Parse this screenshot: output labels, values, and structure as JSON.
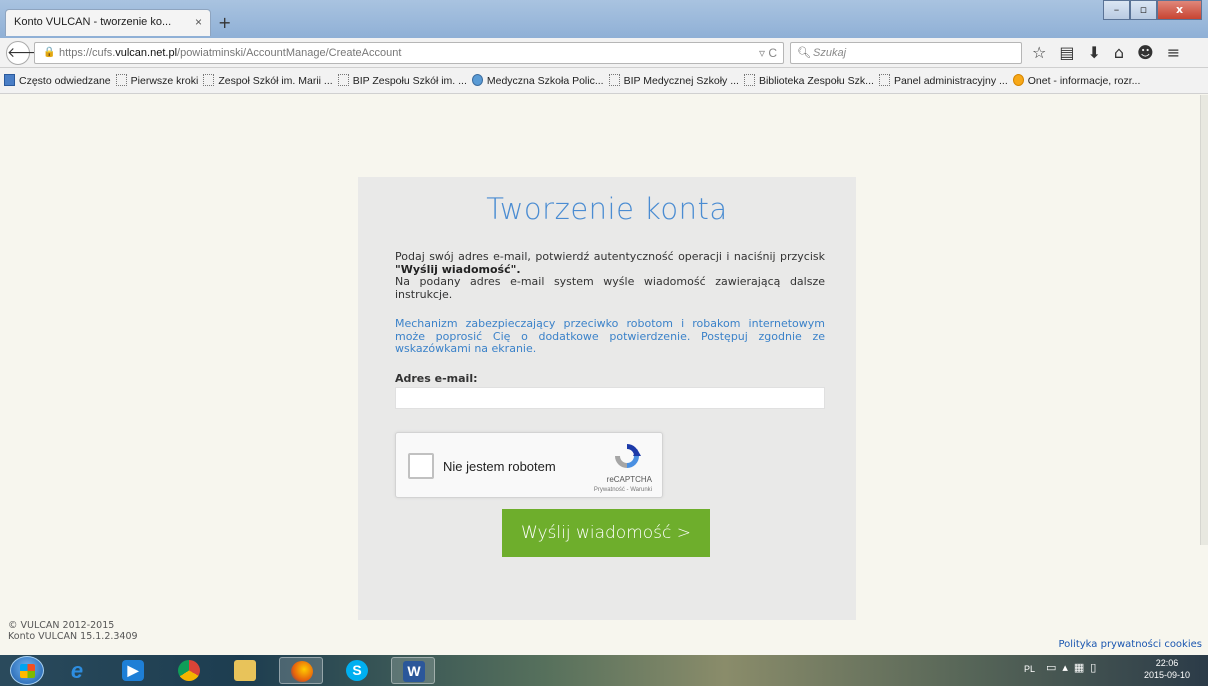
{
  "browser": {
    "tab_title": "Konto VULCAN - tworzenie ko...",
    "tab_close": "×",
    "new_tab": "+",
    "win_min": "–",
    "win_max": "▫",
    "win_close": "x",
    "url_prefix": "https://cufs.",
    "url_host": "vulcan.net.pl",
    "url_path": "/powiatminski/AccountManage/CreateAccount",
    "url_tools": "▿ C",
    "search_placeholder": "Szukaj",
    "icons": [
      "star-icon",
      "reading-list-icon",
      "download-icon",
      "home-icon",
      "chat-icon",
      "menu-icon"
    ]
  },
  "bookmarks": [
    {
      "label": "Często odwiedzane",
      "icon": "blue"
    },
    {
      "label": "Pierwsze kroki",
      "icon": "page"
    },
    {
      "label": "Zespoł Szkół im. Marii ...",
      "icon": "page"
    },
    {
      "label": "BIP Zespołu Szkół im. ...",
      "icon": "page"
    },
    {
      "label": "Medyczna Szkoła Polic...",
      "icon": "globe"
    },
    {
      "label": "BIP Medycznej Szkoły ...",
      "icon": "page"
    },
    {
      "label": "Biblioteka Zespołu Szk...",
      "icon": "page"
    },
    {
      "label": "Panel administracyjny ...",
      "icon": "page"
    },
    {
      "label": "Onet - informacje, rozr...",
      "icon": "orange"
    }
  ],
  "form": {
    "title": "Tworzenie konta",
    "intro_1": "Podaj swój adres e-mail, potwierdź autentyczność operacji i naciśnij przycisk ",
    "intro_bold": "\"Wyślij wiadomość\".",
    "intro_2": "Na podany adres e-mail system wyśle wiadomość zawierającą dalsze instrukcje.",
    "robot_note": "Mechanizm zabezpieczający przeciwko robotom i robakom internetowym może poprosić Cię o dodatkowe potwierdzenie. Postępuj zgodnie ze wskazówkami na ekranie.",
    "email_label": "Adres e-mail:",
    "email_value": "",
    "captcha_label": "Nie jestem robotem",
    "captcha_brand": "reCAPTCHA",
    "captcha_links": "Prywatność - Warunki",
    "send_button": "Wyślij wiadomość >"
  },
  "footer": {
    "copyright": "© VULCAN 2012-2015",
    "version": "Konto VULCAN 15.1.2.3409",
    "privacy_link": "Polityka prywatności cookies"
  },
  "taskbar": {
    "lang": "PL",
    "time": "22:06",
    "date": "2015-09-10",
    "word_label": "W",
    "skype_label": "S"
  },
  "colors": {
    "title_blue": "#4a8cd2",
    "button_green": "#6eae2c",
    "note_blue": "#3b82c9"
  }
}
